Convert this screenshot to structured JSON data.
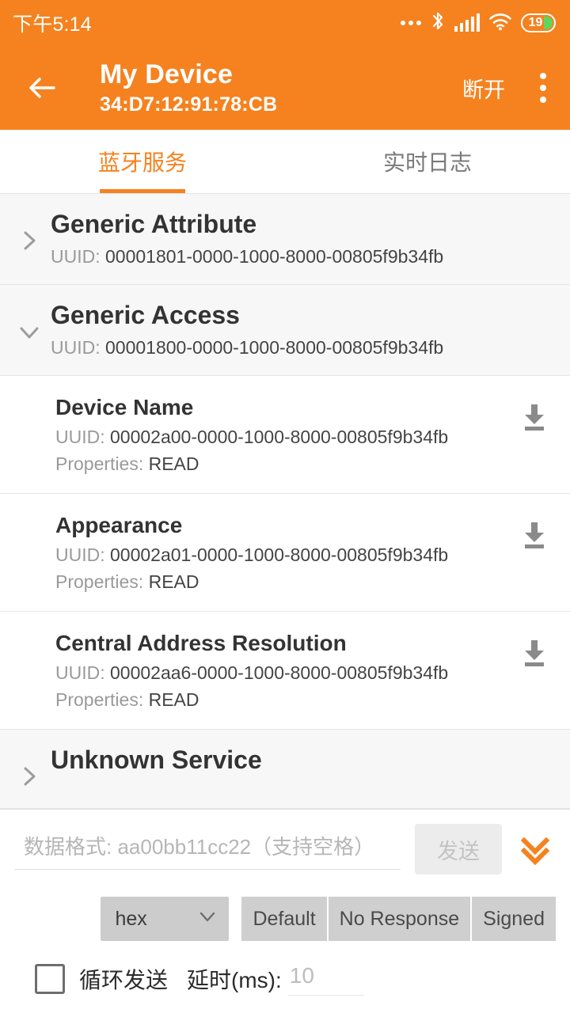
{
  "statusbar": {
    "time": "下午5:14",
    "icons": [
      "more-dots-icon",
      "bluetooth-icon",
      "cellular-signal-icon",
      "wifi-icon",
      "battery-icon"
    ],
    "battery_level": "19"
  },
  "appbar": {
    "back_icon": "back-arrow-icon",
    "title": "My Device",
    "subtitle": "34:D7:12:91:78:CB",
    "action_label": "断开",
    "overflow_icon": "kebab-menu-icon",
    "accent_color": "#F5821F"
  },
  "tabs": [
    {
      "label": "蓝牙服务",
      "active": true
    },
    {
      "label": "实时日志",
      "active": false
    }
  ],
  "labels": {
    "uuid_prefix": "UUID: ",
    "properties_prefix": "Properties: "
  },
  "services": [
    {
      "name": "Generic Attribute",
      "uuid": "00001801-0000-1000-8000-00805f9b34fb",
      "expanded": false,
      "chevron": "chevron-right-icon",
      "characteristics": []
    },
    {
      "name": "Generic Access",
      "uuid": "00001800-0000-1000-8000-00805f9b34fb",
      "expanded": true,
      "chevron": "chevron-down-icon",
      "characteristics": [
        {
          "name": "Device Name",
          "uuid": "00002a00-0000-1000-8000-00805f9b34fb",
          "properties": "READ",
          "action_icon": "download-read-icon"
        },
        {
          "name": "Appearance",
          "uuid": "00002a01-0000-1000-8000-00805f9b34fb",
          "properties": "READ",
          "action_icon": "download-read-icon"
        },
        {
          "name": "Central Address Resolution",
          "uuid": "00002aa6-0000-1000-8000-00805f9b34fb",
          "properties": "READ",
          "action_icon": "download-read-icon"
        }
      ]
    },
    {
      "name": "Unknown Service",
      "uuid": "",
      "expanded": false,
      "chevron": "chevron-right-icon",
      "characteristics": []
    }
  ],
  "composer": {
    "data_input_value": "",
    "data_input_placeholder": "数据格式: aa00bb11cc22（支持空格）",
    "send_label": "发送",
    "send_enabled": false,
    "expand_icon": "double-chevron-down-icon",
    "expand_icon_color": "#F5821F",
    "format_select_value": "hex",
    "format_select_icon": "chevron-down-icon",
    "write_modes": [
      "Default",
      "No Response",
      "Signed"
    ],
    "loop_checkbox_label": "循环发送",
    "loop_checked": false,
    "delay_label": "延时(ms):",
    "delay_value": "",
    "delay_placeholder": "10"
  }
}
